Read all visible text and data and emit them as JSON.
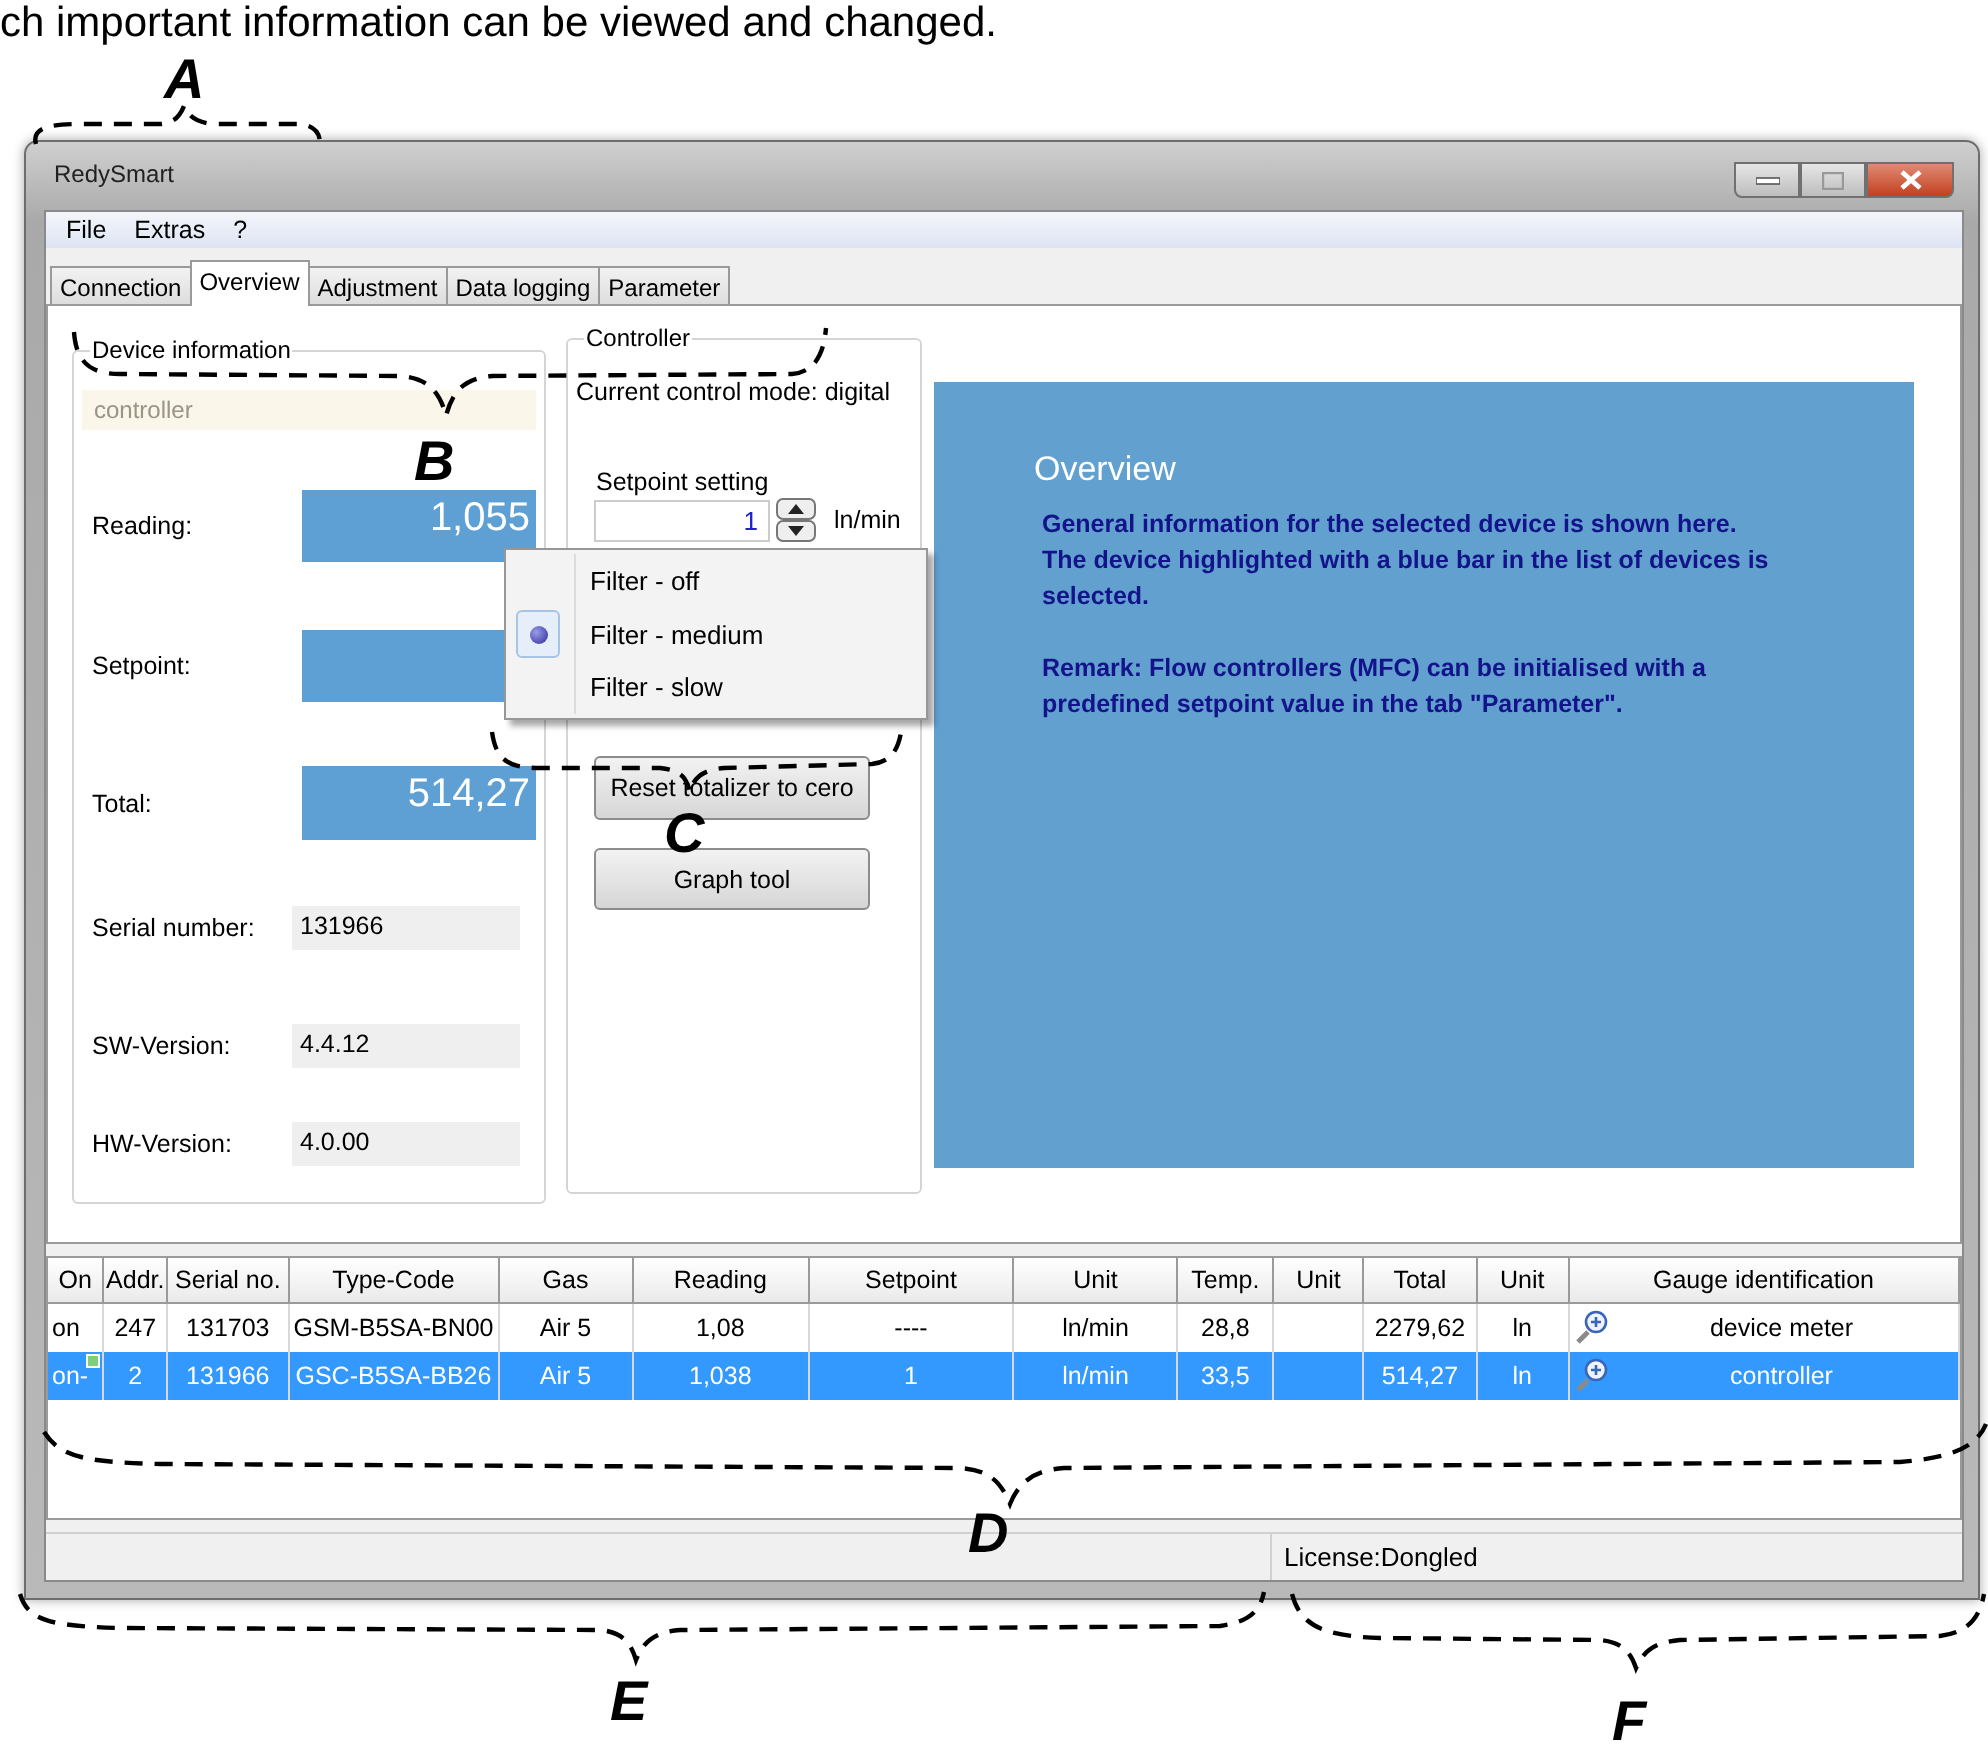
{
  "caption": "ch important information can be viewed and changed.",
  "window": {
    "title": "RedySmart"
  },
  "menu": [
    "File",
    "Extras",
    "?"
  ],
  "tabs": [
    {
      "label": "Connection",
      "selected": false
    },
    {
      "label": "Overview",
      "selected": true
    },
    {
      "label": "Adjustment",
      "selected": false
    },
    {
      "label": "Data logging",
      "selected": false
    },
    {
      "label": "Parameter",
      "selected": false
    }
  ],
  "device_information": {
    "title": "Device information",
    "device_name": "controller",
    "fields": [
      {
        "kind": "display",
        "label": "Reading:",
        "value": "1,055"
      },
      {
        "kind": "display",
        "label": "Setpoint:"
      },
      {
        "kind": "display",
        "label": "Total:",
        "value": "514,27"
      },
      {
        "kind": "info",
        "label": "Serial number:",
        "value": "131966"
      },
      {
        "kind": "info",
        "label": "SW-Version:",
        "value": "4.4.12"
      },
      {
        "kind": "info",
        "label": "HW-Version:",
        "value": "4.0.00"
      }
    ]
  },
  "controller": {
    "title": "Controller",
    "mode": "Current control mode: digital",
    "setpoint_label": "Setpoint setting",
    "setpoint_value": "1",
    "unit": "ln/min",
    "buttons": [
      "Reset totalizer to cero",
      "Graph tool"
    ]
  },
  "context_menu": [
    {
      "label": "Filter - off",
      "selected": false
    },
    {
      "label": "Filter - medium",
      "selected": true
    },
    {
      "label": "Filter - slow",
      "selected": false
    }
  ],
  "overview_panel": {
    "title": "Overview",
    "blocks": [
      [
        "General information for the selected device is shown here.",
        "The device highlighted with a blue bar in the list of devices is selected."
      ],
      [
        "Remark: Flow controllers (MFC) can be initialised with a predefined setpoint value in the tab \"Parameter\"."
      ]
    ]
  },
  "table": {
    "columns": [
      "On",
      "Addr.",
      "Serial no.",
      "Type-Code",
      "Gas",
      "Reading",
      "Setpoint",
      "Unit",
      "Temp.",
      "Unit",
      "Total",
      "Unit",
      "Gauge identification"
    ],
    "rows": [
      {
        "selected": false,
        "indicator": false,
        "cells": [
          "on",
          "247",
          "131703",
          "GSM-B5SA-BN00",
          "Air 5",
          "1,08",
          "----",
          "ln/min",
          "28,8",
          "",
          "2279,62",
          "ln",
          "device meter"
        ]
      },
      {
        "selected": true,
        "indicator": true,
        "cells": [
          "on-",
          "2",
          "131966",
          "GSC-B5SA-BB26",
          "Air 5",
          "1,038",
          "1",
          "ln/min",
          "33,5",
          "",
          "514,27",
          "ln",
          "controller"
        ]
      }
    ]
  },
  "status_bar": {
    "license": "License:Dongled"
  },
  "annotations": [
    "A",
    "B",
    "C",
    "D",
    "E",
    "F"
  ]
}
